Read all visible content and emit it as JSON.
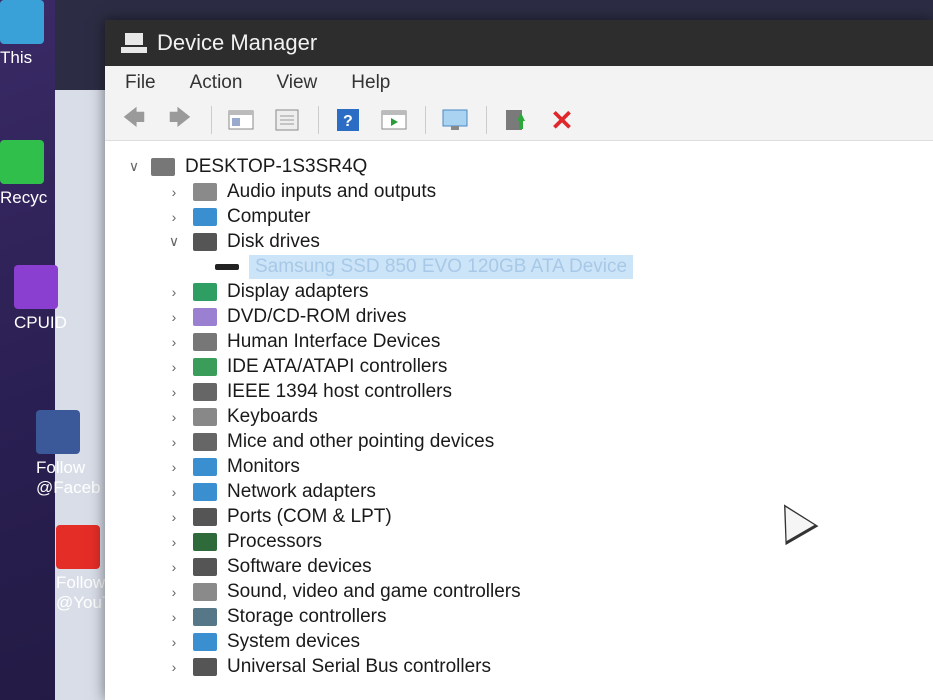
{
  "desktop": {
    "icons": [
      {
        "label": "This",
        "color": "#3aa0d8"
      },
      {
        "label": "Recyc",
        "color": "#2fbf4a"
      },
      {
        "label": "CPUID",
        "color": "#8b3fd0"
      },
      {
        "label": "Follow @Faceb",
        "color": "#3b5998"
      },
      {
        "label": "Follow @YouT",
        "color": "#e52d27"
      }
    ]
  },
  "window": {
    "title": "Device Manager",
    "menu": [
      "File",
      "Action",
      "View",
      "Help"
    ],
    "toolbar_icons": [
      "back-icon",
      "forward-icon",
      "show-hide-tree-icon",
      "properties-icon",
      "help-icon",
      "run-icon",
      "scan-hardware-icon",
      "update-driver-icon",
      "uninstall-icon"
    ],
    "accent_red": "#e0272b"
  },
  "tree": {
    "root": "DESKTOP-1S3SR4Q",
    "items": [
      {
        "label": "Audio inputs and outputs",
        "expanded": false,
        "icon": "speaker-icon",
        "color": "#8a8a8a"
      },
      {
        "label": "Computer",
        "expanded": false,
        "icon": "monitor-icon",
        "color": "#3a8fd0"
      },
      {
        "label": "Disk drives",
        "expanded": true,
        "icon": "disk-icon",
        "color": "#555555"
      },
      {
        "label": "Display adapters",
        "expanded": false,
        "icon": "display-adapter-icon",
        "color": "#2f9e63"
      },
      {
        "label": "DVD/CD-ROM drives",
        "expanded": false,
        "icon": "dvd-icon",
        "color": "#9b7fd1"
      },
      {
        "label": "Human Interface Devices",
        "expanded": false,
        "icon": "hid-icon",
        "color": "#777777"
      },
      {
        "label": "IDE ATA/ATAPI controllers",
        "expanded": false,
        "icon": "ide-icon",
        "color": "#3a9e5a"
      },
      {
        "label": "IEEE 1394 host controllers",
        "expanded": false,
        "icon": "ieee-icon",
        "color": "#666666"
      },
      {
        "label": "Keyboards",
        "expanded": false,
        "icon": "keyboard-icon",
        "color": "#888888"
      },
      {
        "label": "Mice and other pointing devices",
        "expanded": false,
        "icon": "mouse-icon",
        "color": "#666666"
      },
      {
        "label": "Monitors",
        "expanded": false,
        "icon": "monitor-icon",
        "color": "#3a8fd0"
      },
      {
        "label": "Network adapters",
        "expanded": false,
        "icon": "network-icon",
        "color": "#3a8fd0"
      },
      {
        "label": "Ports (COM & LPT)",
        "expanded": false,
        "icon": "port-icon",
        "color": "#555555"
      },
      {
        "label": "Processors",
        "expanded": false,
        "icon": "processor-icon",
        "color": "#2f6b3a"
      },
      {
        "label": "Software devices",
        "expanded": false,
        "icon": "software-icon",
        "color": "#555555"
      },
      {
        "label": "Sound, video and game controllers",
        "expanded": false,
        "icon": "speaker-icon",
        "color": "#8a8a8a"
      },
      {
        "label": "Storage controllers",
        "expanded": false,
        "icon": "storage-icon",
        "color": "#557788"
      },
      {
        "label": "System devices",
        "expanded": false,
        "icon": "system-icon",
        "color": "#3a8fd0"
      },
      {
        "label": "Universal Serial Bus controllers",
        "expanded": false,
        "icon": "usb-icon",
        "color": "#555555"
      }
    ],
    "disk_child": "Samsung SSD 850 EVO 120GB ATA Device"
  }
}
